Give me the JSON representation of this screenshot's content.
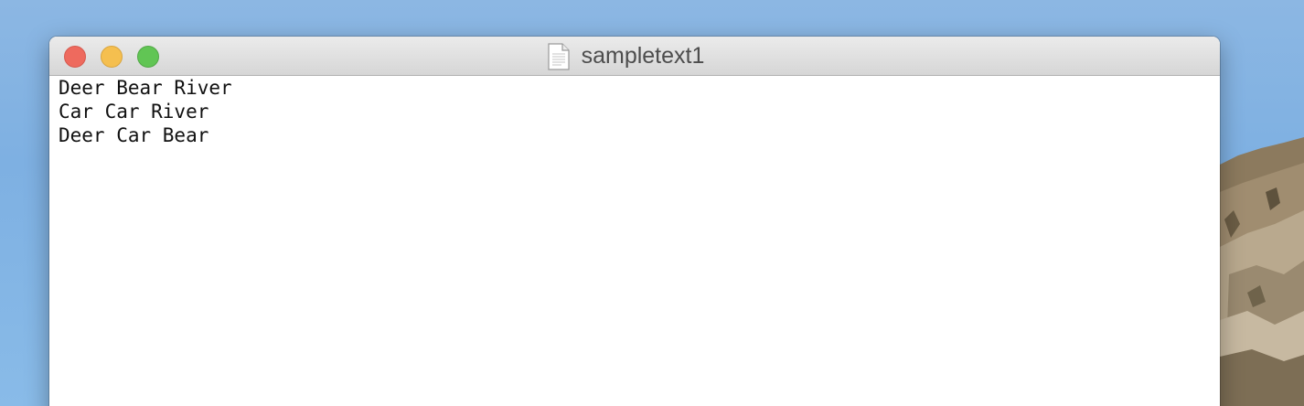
{
  "window": {
    "title": "sampletext1",
    "icon": "document-icon"
  },
  "document": {
    "lines": [
      "Deer Bear River",
      "Car Car River",
      "Deer Car Bear"
    ]
  },
  "colors": {
    "close": "#ee6a5e",
    "minimize": "#f5bf4f",
    "maximize": "#61c554",
    "desktop": "#82b3e4"
  }
}
